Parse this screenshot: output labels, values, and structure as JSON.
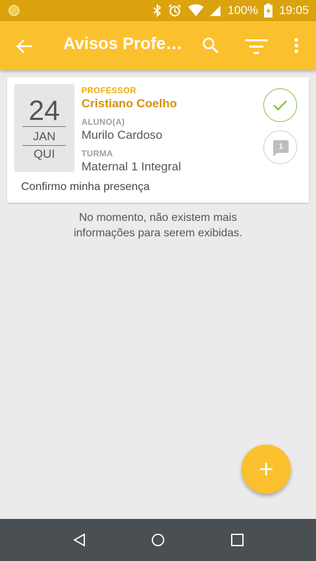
{
  "status_bar": {
    "battery_percent": "100%",
    "time": "19:05",
    "icons": [
      "app-notification-icon",
      "bluetooth-icon",
      "alarm-icon",
      "wifi-icon",
      "cell-signal-icon",
      "battery-charging-icon"
    ]
  },
  "app_bar": {
    "title": "Avisos Professor",
    "icons": [
      "back-arrow-icon",
      "search-icon",
      "filter-icon",
      "more-vert-icon"
    ],
    "color": "#fbc02d"
  },
  "card": {
    "date": {
      "day": "24",
      "month": "JAN",
      "weekday": "QUI"
    },
    "role_label": "PROFESSOR",
    "teacher_name": "Cristiano Coelho",
    "student_label": "ALUNO(A)",
    "student_name": "Murilo Cardoso",
    "class_label": "TURMA",
    "class_name": "Maternal 1 Integral",
    "message": "Confirmo minha presença",
    "comment_count": "1"
  },
  "empty_message_line1": "No momento, não existem mais",
  "empty_message_line2": "informações para serem exibidas.",
  "fab_icon": "plus-icon",
  "nav_icons": [
    "nav-back-icon",
    "nav-home-icon",
    "nav-recents-icon"
  ],
  "colors": {
    "accent": "#fbc02d",
    "status_bar": "#dba30e",
    "check_green": "#8bc34a",
    "teacher_text": "#d4920b"
  }
}
